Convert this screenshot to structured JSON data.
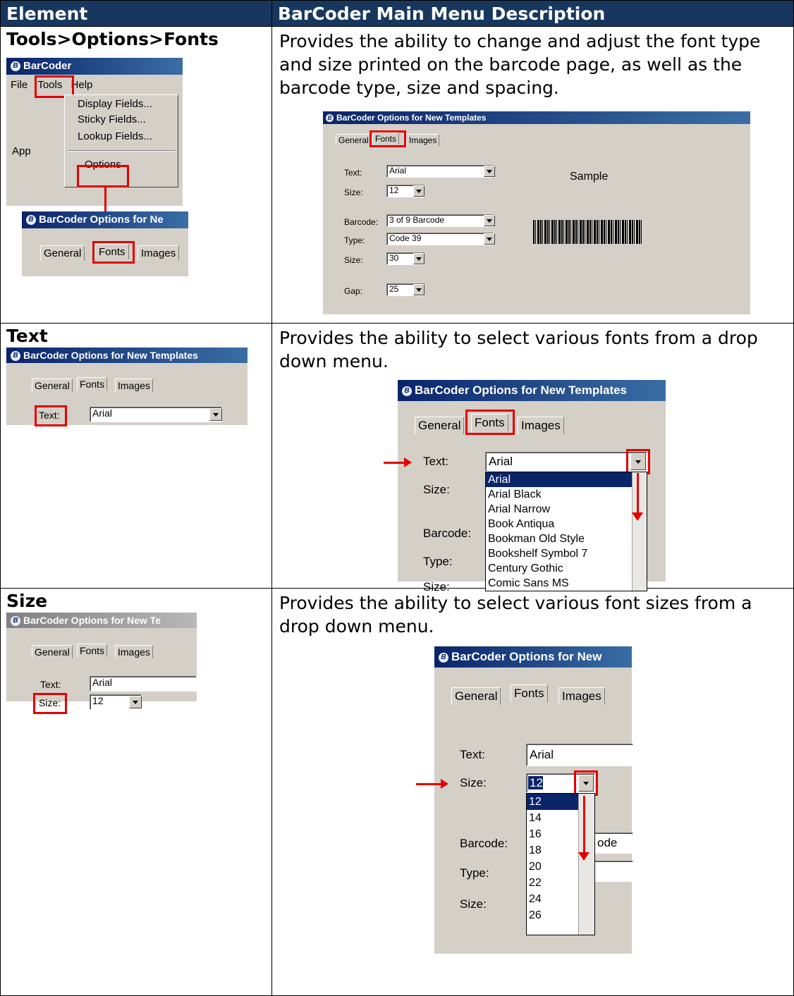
{
  "header": {
    "col1": "Element",
    "col2": "BarCoder Main Menu Description"
  },
  "rows": [
    {
      "element": "Tools>Options>Fonts",
      "description": "Provides the ability to change and adjust the font type and size printed on the barcode page, as well as the barcode type, size and spacing.",
      "menu_shot": {
        "title": "BarCoder",
        "menubar": [
          "File",
          "Tools",
          "Help"
        ],
        "menu_items": [
          "Display Fields...",
          "Sticky Fields...",
          "Lookup Fields...",
          "Options"
        ],
        "behind_text": "App",
        "options_title": "BarCoder Options for Ne",
        "tabs": [
          "General",
          "Fonts",
          "Images"
        ]
      },
      "options_shot": {
        "title": "BarCoder Options for New Templates",
        "tabs": [
          "General",
          "Fonts",
          "Images"
        ],
        "labels": {
          "text": "Text:",
          "size": "Size:",
          "barcode": "Barcode:",
          "type": "Type:",
          "bsize": "Size:",
          "gap": "Gap:"
        },
        "values": {
          "text": "Arial",
          "size": "12",
          "barcode": "3 of 9 Barcode",
          "type": "Code 39",
          "bsize": "30",
          "gap": "25"
        },
        "sample": "Sample"
      }
    },
    {
      "element": "Text",
      "description": "Provides the ability to select various fonts from a drop down menu.",
      "small_shot": {
        "title": "BarCoder Options for New Templates",
        "tabs": [
          "General",
          "Fonts",
          "Images"
        ],
        "label": "Text:",
        "value": "Arial"
      },
      "big_shot": {
        "title": "BarCoder Options for New Templates",
        "tabs": [
          "General",
          "Fonts",
          "Images"
        ],
        "labels": [
          "Text:",
          "Size:",
          "Barcode:",
          "Type:",
          "Size:"
        ],
        "value": "Arial",
        "font_list": [
          "Arial",
          "Arial Black",
          "Arial Narrow",
          "Book Antiqua",
          "Bookman Old Style",
          "Bookshelf Symbol 7",
          "Century Gothic",
          "Comic Sans MS"
        ]
      }
    },
    {
      "element": "Size",
      "description": "Provides the ability to select various font sizes from a drop down menu.",
      "small_shot": {
        "title": "BarCoder Options for New Te",
        "tabs": [
          "General",
          "Fonts",
          "Images"
        ],
        "text_label": "Text:",
        "text_value": "Arial",
        "size_label": "Size:",
        "size_value": "12"
      },
      "big_shot": {
        "title": "BarCoder Options for New",
        "tabs": [
          "General",
          "Fonts",
          "Images"
        ],
        "labels": [
          "Text:",
          "Size:",
          "Barcode:",
          "Type:",
          "Size:"
        ],
        "text_value": "Arial",
        "size_value": "12",
        "barcode_partial": "ode",
        "size_list": [
          "12",
          "14",
          "16",
          "18",
          "20",
          "22",
          "24",
          "26"
        ]
      }
    }
  ]
}
